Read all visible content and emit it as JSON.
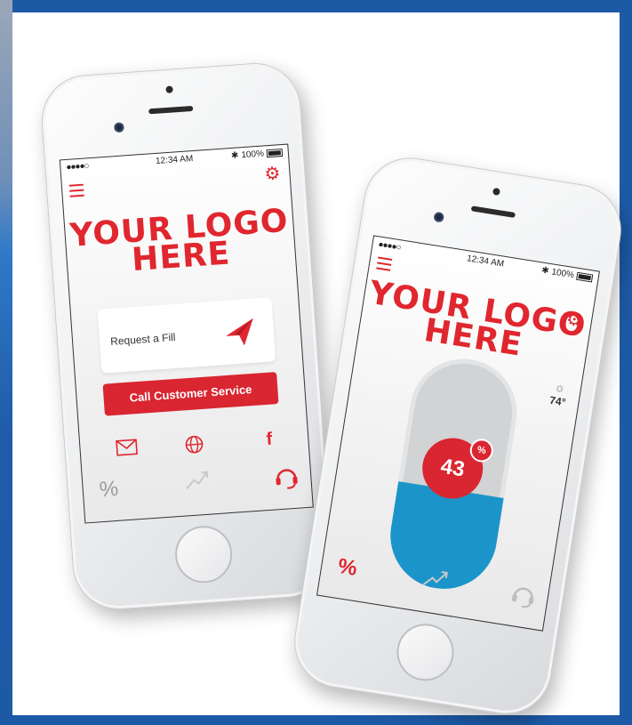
{
  "colors": {
    "brand_red": "#e0262e",
    "tank_blue": "#1b95c9",
    "frame_blue": "#1d5aa6"
  },
  "phone_left": {
    "status": {
      "signal": "●●●●○",
      "time": "12:34 AM",
      "battery": "100%"
    },
    "logo_line1": "YOUR LOGO",
    "logo_line2": "HERE",
    "request_fill_label": "Request a Fill",
    "call_button_label": "Call Customer Service",
    "social_icons": [
      "envelope-icon",
      "globe-icon",
      "facebook-icon"
    ],
    "tabs": {
      "percent": "%",
      "trend": "trend-icon",
      "support": "headset-icon"
    }
  },
  "phone_right": {
    "status": {
      "signal": "●●●●○",
      "time": "12:34 AM",
      "battery": "100%"
    },
    "logo_line1": "YOUR LOGO",
    "logo_line2": "HERE",
    "temperature": "74°",
    "tank_level_value": "43",
    "tank_level_unit": "%",
    "tank_level_fraction": 0.43,
    "tabs": {
      "percent": "%",
      "trend": "trend-icon",
      "support": "headset-icon"
    }
  }
}
